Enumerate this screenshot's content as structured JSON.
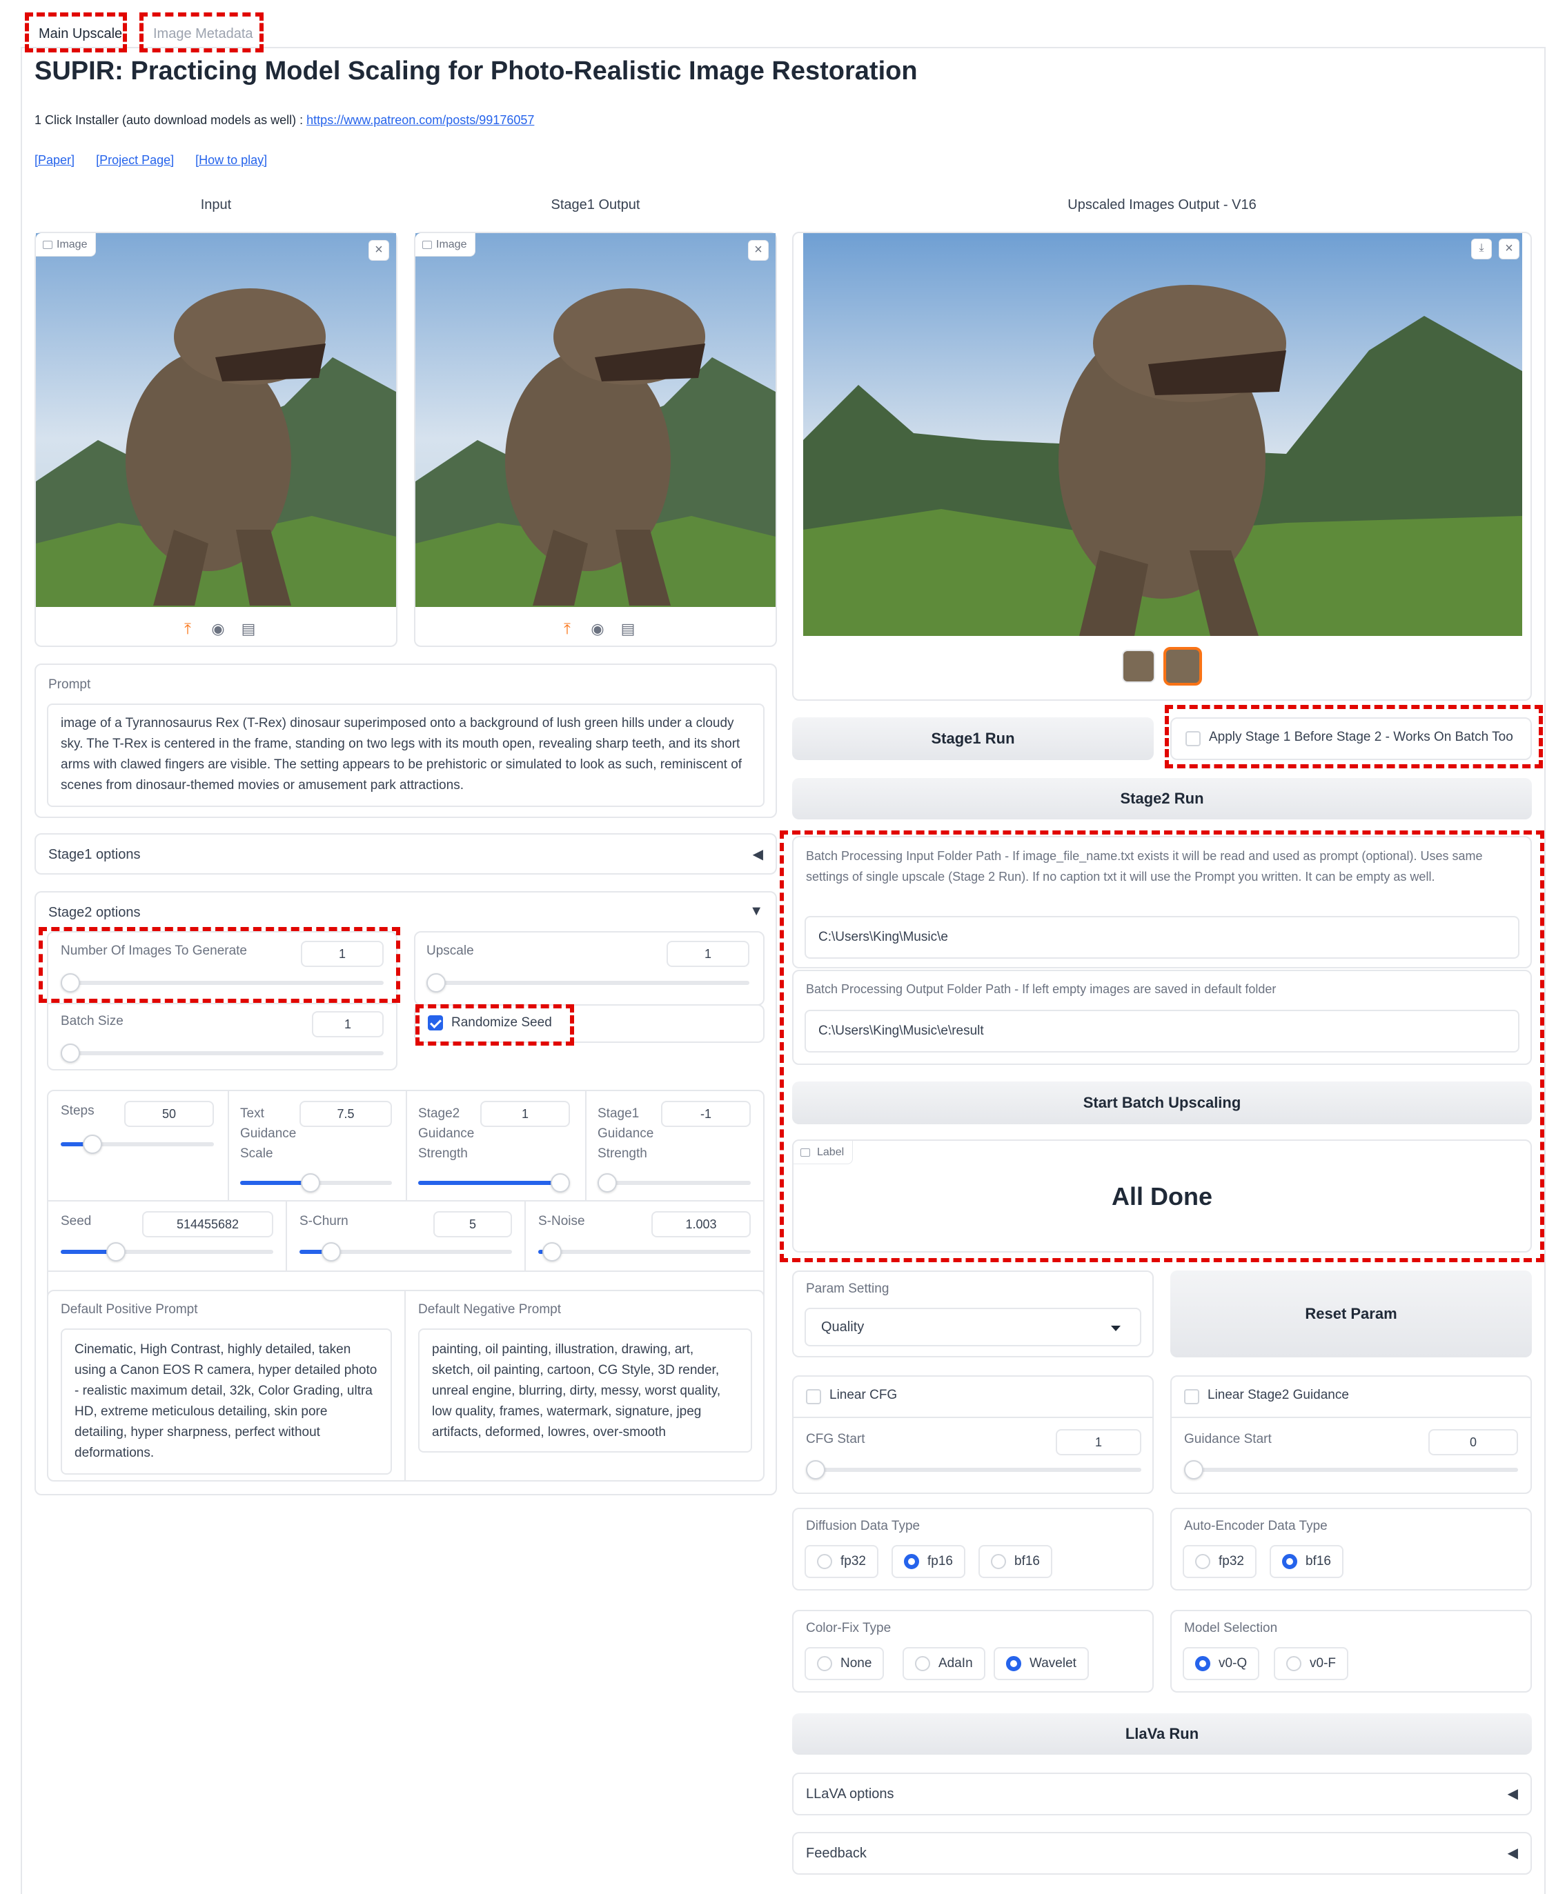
{
  "tabs": [
    {
      "label": "Main Upscale",
      "active": true
    },
    {
      "label": "Image Metadata",
      "active": false
    }
  ],
  "title": "SUPIR: Practicing Model Scaling for Photo-Realistic Image Restoration",
  "installer": {
    "text": "1 Click Installer (auto download models as well) : ",
    "link": "https://www.patreon.com/posts/99176057"
  },
  "links": [
    "[Paper]",
    "[Project Page]",
    "[How to play]"
  ],
  "columns": {
    "input": "Input",
    "stage1_output": "Stage1 Output",
    "upscaled_output": "Upscaled Images Output - V16"
  },
  "image_label": "Image",
  "prompt": {
    "label": "Prompt",
    "value": "image of a Tyrannosaurus Rex (T-Rex) dinosaur superimposed onto a background of lush green hills under a cloudy sky. The T-Rex is centered in the frame, standing on two legs with its mouth open, revealing sharp teeth, and its short arms with clawed fingers are visible. The setting appears to be prehistoric or simulated to look as such, reminiscent of scenes from dinosaur-themed movies or amusement park attractions."
  },
  "stage1_options": {
    "label": "Stage1 options"
  },
  "stage2_options": {
    "label": "Stage2 options",
    "num_images": {
      "label": "Number Of Images To Generate",
      "value": "1"
    },
    "upscale": {
      "label": "Upscale",
      "value": "1"
    },
    "batch_size": {
      "label": "Batch Size",
      "value": "1"
    },
    "randomize_seed": {
      "label": "Randomize Seed",
      "checked": true
    },
    "steps": {
      "label": "Steps",
      "value": "50"
    },
    "text_guidance": {
      "label": "Text Guidance Scale",
      "value": "7.5"
    },
    "stage2_guidance": {
      "label": "Stage2 Guidance Strength",
      "value": "1"
    },
    "stage1_guidance": {
      "label": "Stage1 Guidance Strength",
      "value": "-1"
    },
    "seed": {
      "label": "Seed",
      "value": "514455682"
    },
    "s_churn": {
      "label": "S-Churn",
      "value": "5"
    },
    "s_noise": {
      "label": "S-Noise",
      "value": "1.003"
    },
    "default_positive": {
      "label": "Default Positive Prompt",
      "value": "Cinematic, High Contrast, highly detailed, taken using a Canon EOS R camera, hyper detailed photo - realistic maximum detail, 32k, Color Grading, ultra HD, extreme meticulous detailing, skin pore detailing, hyper sharpness, perfect without deformations."
    },
    "default_negative": {
      "label": "Default Negative Prompt",
      "value": "painting, oil painting, illustration, drawing, art, sketch, oil painting, cartoon, CG Style, 3D render, unreal engine, blurring, dirty, messy, worst quality, low quality, frames, watermark, signature, jpeg artifacts, deformed, lowres, over-smooth"
    }
  },
  "right": {
    "stage1_run": "Stage1 Run",
    "apply_stage1": {
      "label": "Apply Stage 1 Before Stage 2 - Works On Batch Too",
      "checked": false
    },
    "stage2_run": "Stage2 Run",
    "batch_input": {
      "label": "Batch Processing Input Folder Path - If image_file_name.txt exists it will be read and used as prompt (optional). Uses same settings of single upscale (Stage 2 Run). If no caption txt it will use the Prompt you written. It can be empty as well.",
      "value": "C:\\Users\\King\\Music\\e"
    },
    "batch_output": {
      "label": "Batch Processing Output Folder Path - If left empty images are saved in default folder",
      "value": "C:\\Users\\King\\Music\\e\\result"
    },
    "start_batch": "Start Batch Upscaling",
    "status_label": "Label",
    "status_value": "All Done",
    "param_setting": {
      "label": "Param Setting",
      "value": "Quality"
    },
    "reset_param": "Reset Param",
    "linear_cfg": {
      "label": "Linear CFG",
      "checked": false
    },
    "linear_stage2": {
      "label": "Linear Stage2 Guidance",
      "checked": false
    },
    "cfg_start": {
      "label": "CFG Start",
      "value": "1"
    },
    "guidance_start": {
      "label": "Guidance Start",
      "value": "0"
    },
    "diffusion_dtype": {
      "label": "Diffusion Data Type",
      "options": [
        "fp32",
        "fp16",
        "bf16"
      ],
      "selected": "fp16"
    },
    "ae_dtype": {
      "label": "Auto-Encoder Data Type",
      "options": [
        "fp32",
        "bf16"
      ],
      "selected": "bf16"
    },
    "color_fix": {
      "label": "Color-Fix Type",
      "options": [
        "None",
        "AdaIn",
        "Wavelet"
      ],
      "selected": "Wavelet"
    },
    "model_selection": {
      "label": "Model Selection",
      "options": [
        "v0-Q",
        "v0-F"
      ],
      "selected": "v0-Q"
    },
    "llava_run": "LlaVa Run",
    "llava_options": "LLaVA options",
    "feedback": "Feedback"
  },
  "colors": {
    "accent": "#2563eb",
    "annotation_red": "#e10600",
    "upload_orange": "#f97316"
  },
  "icons": [
    "upload-icon",
    "webcam-icon",
    "clipboard-icon",
    "close-icon",
    "download-icon",
    "image-icon",
    "label-icon"
  ]
}
